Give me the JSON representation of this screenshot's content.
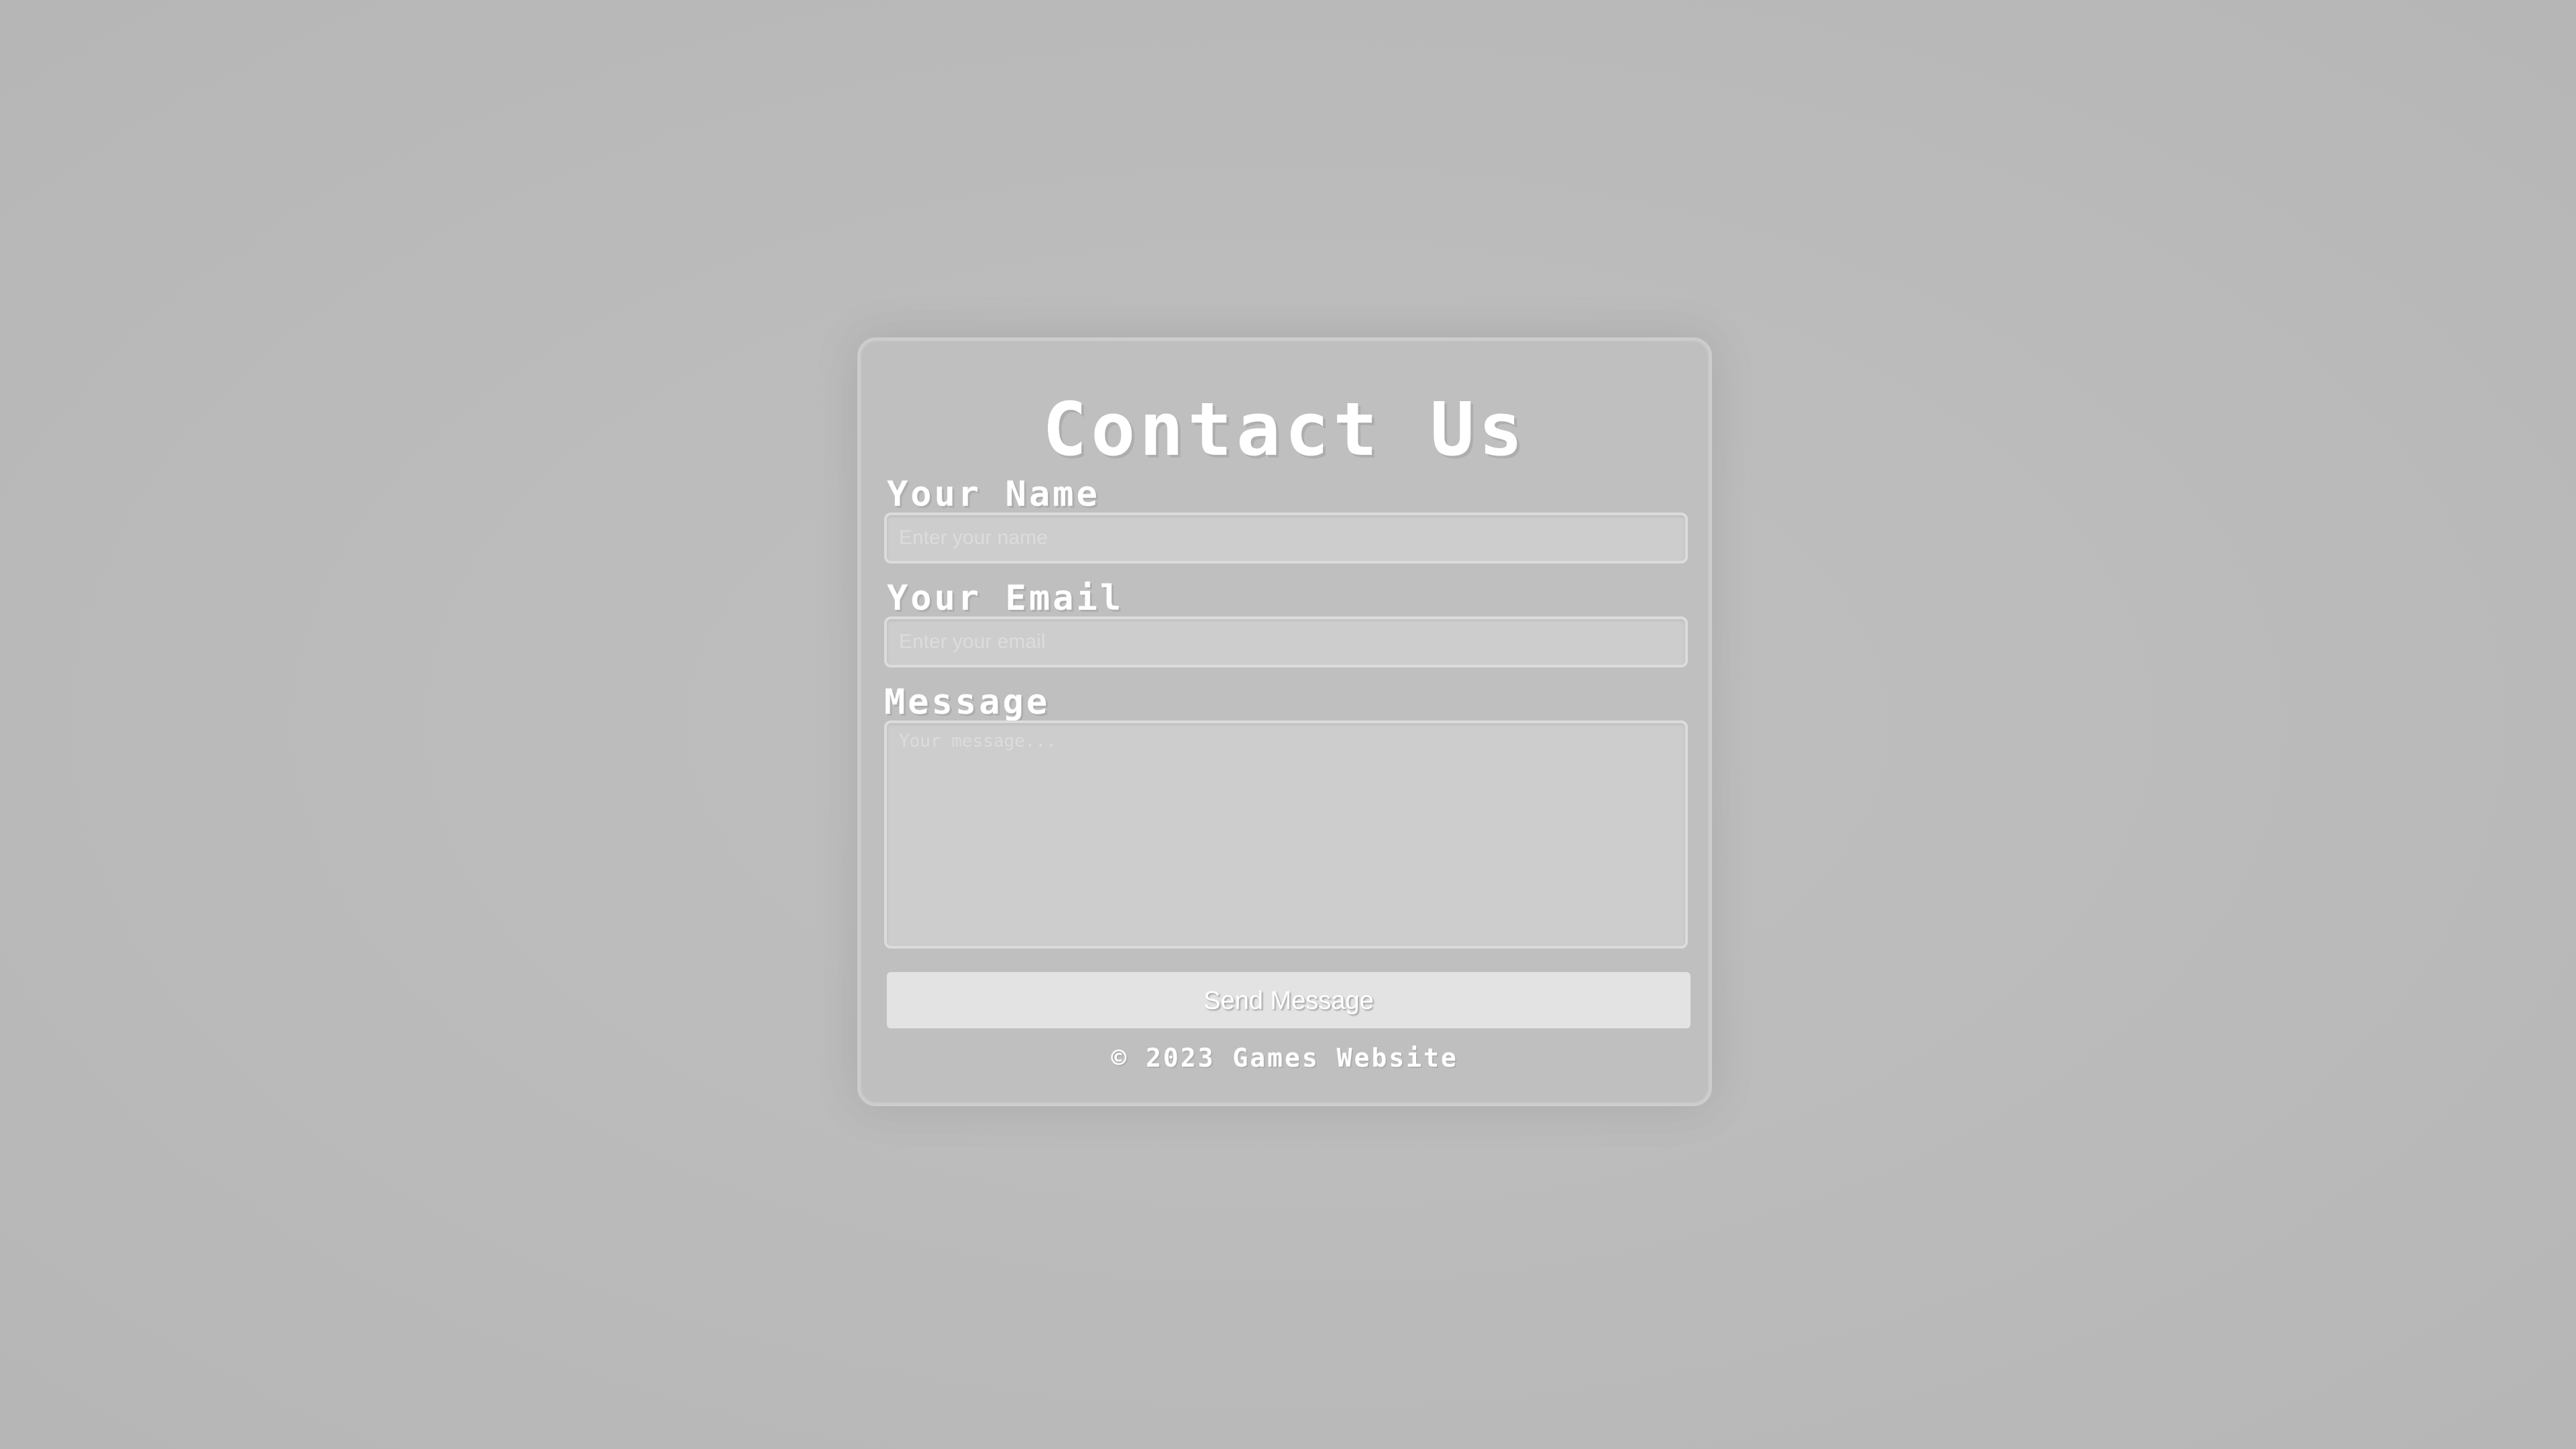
{
  "contact_form": {
    "title": "Contact Us",
    "name_label": "Your Name",
    "name_placeholder": "Enter your name",
    "name_value": "",
    "email_label": "Your Email",
    "email_placeholder": "Enter your email",
    "email_value": "",
    "message_label": "Message",
    "message_placeholder": "Your message...",
    "message_value": "",
    "submit_label": "Send Message",
    "footer_text": "© 2023 Games Website"
  },
  "colors": {
    "background": "#bababa",
    "card": "#bfbfbf",
    "text": "#ffffff",
    "button": "#e3e3e3"
  }
}
